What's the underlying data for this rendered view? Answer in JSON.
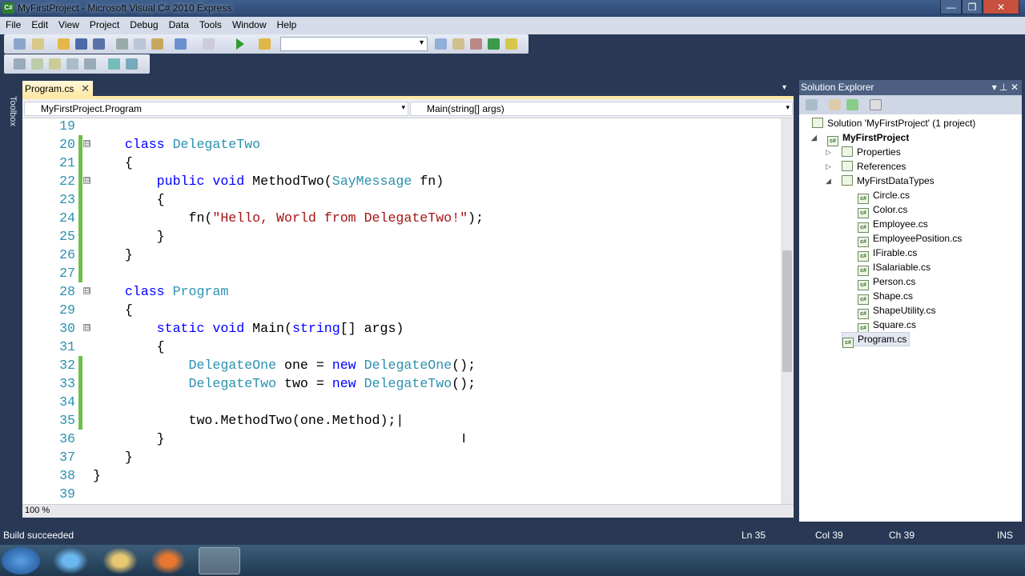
{
  "window": {
    "title": "MyFirstProject - Microsoft Visual C# 2010 Express",
    "app_icon": "C#",
    "minimize": "—",
    "maximize": "❐",
    "close": "✕"
  },
  "menu": [
    "File",
    "Edit",
    "View",
    "Project",
    "Debug",
    "Data",
    "Tools",
    "Window",
    "Help"
  ],
  "toolbar": {
    "solution_config_value": ""
  },
  "sidebar": {
    "toolbox_label": "Toolbox"
  },
  "document": {
    "tab_label": "Program.cs",
    "tab_close": "✕",
    "type_dropdown": "MyFirstProject.Program",
    "member_dropdown": "Main(string[] args)",
    "zoom": "100 %"
  },
  "code": {
    "lines": [
      {
        "num": "19",
        "changed": false,
        "fold": "",
        "tokens": []
      },
      {
        "num": "20",
        "changed": true,
        "fold": "⊟",
        "tokens": [
          {
            "t": "    ",
            "c": "p"
          },
          {
            "t": "class ",
            "c": "k"
          },
          {
            "t": "DelegateTwo",
            "c": "ty"
          }
        ]
      },
      {
        "num": "21",
        "changed": true,
        "fold": "",
        "tokens": [
          {
            "t": "    {",
            "c": "p"
          }
        ]
      },
      {
        "num": "22",
        "changed": true,
        "fold": "⊟",
        "tokens": [
          {
            "t": "        ",
            "c": "p"
          },
          {
            "t": "public void ",
            "c": "k"
          },
          {
            "t": "MethodTwo(",
            "c": "p"
          },
          {
            "t": "SayMessage",
            "c": "ty"
          },
          {
            "t": " fn)",
            "c": "p"
          }
        ]
      },
      {
        "num": "23",
        "changed": true,
        "fold": "",
        "tokens": [
          {
            "t": "        {",
            "c": "p"
          }
        ]
      },
      {
        "num": "24",
        "changed": true,
        "fold": "",
        "tokens": [
          {
            "t": "            fn(",
            "c": "p"
          },
          {
            "t": "\"Hello, World from DelegateTwo!\"",
            "c": "s"
          },
          {
            "t": ");",
            "c": "p"
          }
        ]
      },
      {
        "num": "25",
        "changed": true,
        "fold": "",
        "tokens": [
          {
            "t": "        }",
            "c": "p"
          }
        ]
      },
      {
        "num": "26",
        "changed": true,
        "fold": "",
        "tokens": [
          {
            "t": "    }",
            "c": "p"
          }
        ]
      },
      {
        "num": "27",
        "changed": true,
        "fold": "",
        "tokens": []
      },
      {
        "num": "28",
        "changed": false,
        "fold": "⊟",
        "tokens": [
          {
            "t": "    ",
            "c": "p"
          },
          {
            "t": "class ",
            "c": "k"
          },
          {
            "t": "Program",
            "c": "ty"
          }
        ]
      },
      {
        "num": "29",
        "changed": false,
        "fold": "",
        "tokens": [
          {
            "t": "    {",
            "c": "p"
          }
        ]
      },
      {
        "num": "30",
        "changed": false,
        "fold": "⊟",
        "tokens": [
          {
            "t": "        ",
            "c": "p"
          },
          {
            "t": "static void ",
            "c": "k"
          },
          {
            "t": "Main(",
            "c": "p"
          },
          {
            "t": "string",
            "c": "k"
          },
          {
            "t": "[] args)",
            "c": "p"
          }
        ]
      },
      {
        "num": "31",
        "changed": false,
        "fold": "",
        "tokens": [
          {
            "t": "        {",
            "c": "p"
          }
        ]
      },
      {
        "num": "32",
        "changed": true,
        "fold": "",
        "tokens": [
          {
            "t": "            ",
            "c": "p"
          },
          {
            "t": "DelegateOne",
            "c": "ty"
          },
          {
            "t": " one = ",
            "c": "p"
          },
          {
            "t": "new ",
            "c": "k"
          },
          {
            "t": "DelegateOne",
            "c": "ty"
          },
          {
            "t": "();",
            "c": "p"
          }
        ]
      },
      {
        "num": "33",
        "changed": true,
        "fold": "",
        "tokens": [
          {
            "t": "            ",
            "c": "p"
          },
          {
            "t": "DelegateTwo",
            "c": "ty"
          },
          {
            "t": " two = ",
            "c": "p"
          },
          {
            "t": "new ",
            "c": "k"
          },
          {
            "t": "DelegateTwo",
            "c": "ty"
          },
          {
            "t": "();",
            "c": "p"
          }
        ]
      },
      {
        "num": "34",
        "changed": true,
        "fold": "",
        "tokens": []
      },
      {
        "num": "35",
        "changed": true,
        "fold": "",
        "tokens": [
          {
            "t": "            two.MethodTwo(one.Method);|",
            "c": "p"
          }
        ]
      },
      {
        "num": "36",
        "changed": false,
        "fold": "",
        "tokens": [
          {
            "t": "        }",
            "c": "p"
          }
        ]
      },
      {
        "num": "37",
        "changed": false,
        "fold": "",
        "tokens": [
          {
            "t": "    }",
            "c": "p"
          }
        ]
      },
      {
        "num": "38",
        "changed": false,
        "fold": "",
        "tokens": [
          {
            "t": "}",
            "c": "p"
          }
        ]
      },
      {
        "num": "39",
        "changed": false,
        "fold": "",
        "tokens": []
      }
    ]
  },
  "solution_explorer": {
    "title": "Solution Explorer",
    "controls": "▾ ⊥ ✕",
    "nodes": [
      {
        "label": "Solution 'MyFirstProject' (1 project)",
        "level": 0,
        "arrow": "",
        "bold": false,
        "icon": "solution-icon"
      },
      {
        "label": "MyFirstProject",
        "level": 1,
        "arrow": "◢",
        "bold": true,
        "icon": "csharp-project-icon"
      },
      {
        "label": "Properties",
        "level": 2,
        "arrow": "▷",
        "bold": false,
        "icon": "properties-icon"
      },
      {
        "label": "References",
        "level": 2,
        "arrow": "▷",
        "bold": false,
        "icon": "references-icon"
      },
      {
        "label": "MyFirstDataTypes",
        "level": 2,
        "arrow": "◢",
        "bold": false,
        "icon": "folder-icon"
      },
      {
        "label": "Circle.cs",
        "level": 3,
        "arrow": "",
        "bold": false,
        "icon": "csharp-file-icon"
      },
      {
        "label": "Color.cs",
        "level": 3,
        "arrow": "",
        "bold": false,
        "icon": "csharp-file-icon"
      },
      {
        "label": "Employee.cs",
        "level": 3,
        "arrow": "",
        "bold": false,
        "icon": "csharp-file-icon"
      },
      {
        "label": "EmployeePosition.cs",
        "level": 3,
        "arrow": "",
        "bold": false,
        "icon": "csharp-file-icon"
      },
      {
        "label": "IFirable.cs",
        "level": 3,
        "arrow": "",
        "bold": false,
        "icon": "csharp-file-icon"
      },
      {
        "label": "ISalariable.cs",
        "level": 3,
        "arrow": "",
        "bold": false,
        "icon": "csharp-file-icon"
      },
      {
        "label": "Person.cs",
        "level": 3,
        "arrow": "",
        "bold": false,
        "icon": "csharp-file-icon"
      },
      {
        "label": "Shape.cs",
        "level": 3,
        "arrow": "",
        "bold": false,
        "icon": "csharp-file-icon"
      },
      {
        "label": "ShapeUtility.cs",
        "level": 3,
        "arrow": "",
        "bold": false,
        "icon": "csharp-file-icon"
      },
      {
        "label": "Square.cs",
        "level": 3,
        "arrow": "",
        "bold": false,
        "icon": "csharp-file-icon"
      },
      {
        "label": "Program.cs",
        "level": 2,
        "arrow": "",
        "bold": false,
        "icon": "csharp-file-icon",
        "selected": true
      }
    ]
  },
  "status": {
    "message": "Build succeeded",
    "ln": "Ln 35",
    "col": "Col 39",
    "ch": "Ch 39",
    "mode": "INS"
  },
  "colors": {
    "keyword": "#0000ff",
    "type": "#2b91af",
    "string": "#a31515",
    "changed": "#6cc04a"
  }
}
